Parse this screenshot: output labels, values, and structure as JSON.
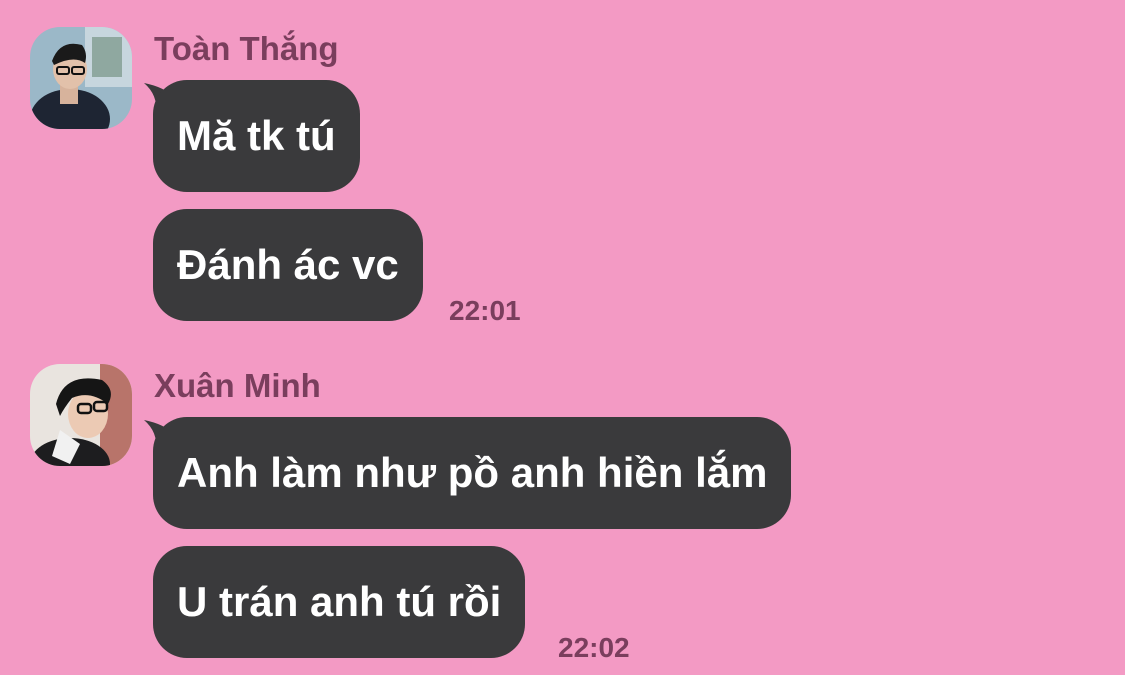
{
  "messages_groups": [
    {
      "sender": "Toàn Thắng",
      "messages": [
        "Mă tk tú",
        "Đánh ác vc"
      ],
      "time": "22:01"
    },
    {
      "sender": "Xuân Minh",
      "messages": [
        "Anh làm như pồ anh hiền lắm",
        "U trán anh tú rồi"
      ],
      "time": "22:02"
    }
  ],
  "colors": {
    "background": "#f39ac4",
    "bubble": "#3a3a3c",
    "bubble_text": "#ffffff",
    "name_text": "#7a3e5d"
  }
}
